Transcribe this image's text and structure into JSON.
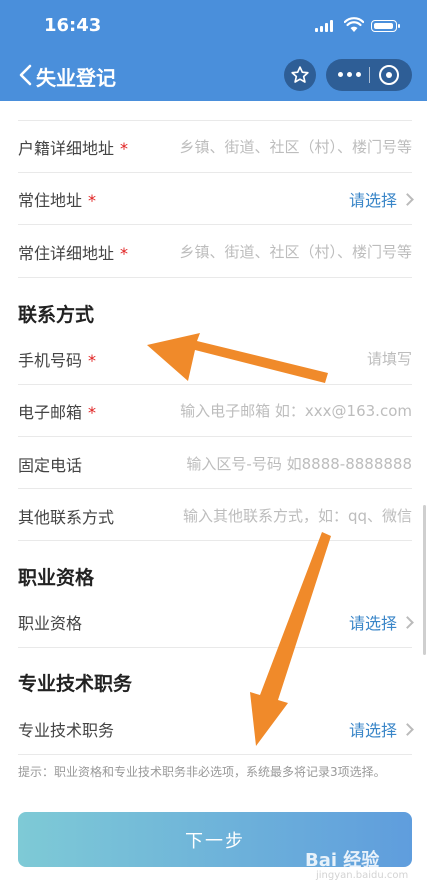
{
  "status": {
    "time": "16:43"
  },
  "nav": {
    "title": "失业登记"
  },
  "form": {
    "rows": [
      {
        "label": "户籍详细地址",
        "placeholder": "乡镇、街道、社区（村）、楼门号等"
      },
      {
        "label": "常住地址",
        "select": "请选择"
      },
      {
        "label": "常住详细地址",
        "placeholder": "乡镇、街道、社区（村）、楼门号等"
      }
    ],
    "contact": {
      "heading": "联系方式",
      "phone": {
        "label": "手机号码",
        "placeholder": "请填写"
      },
      "email": {
        "label": "电子邮箱",
        "placeholder": "输入电子邮箱 如：xxx@163.com"
      },
      "landline": {
        "label": "固定电话",
        "placeholder": "输入区号-号码 如8888-8888888"
      },
      "other": {
        "label": "其他联系方式",
        "placeholder": "输入其他联系方式，如：qq、微信"
      }
    },
    "qualification": {
      "heading": "职业资格",
      "label": "职业资格",
      "select": "请选择"
    },
    "technical": {
      "heading": "专业技术职务",
      "label": "专业技术职务",
      "select": "请选择"
    },
    "required_mark": "*"
  },
  "hint": "提示：职业资格和专业技术职务非必选项，系统最多将记录3项选择。",
  "next_button": "下一步",
  "watermark": {
    "brand": "Bai 经验",
    "url": "jingyan.baidu.com"
  },
  "colors": {
    "header": "#4a8fdb",
    "accent": "#3a86c8",
    "required": "#e02020",
    "annotation_arrow": "#f08a2a"
  }
}
